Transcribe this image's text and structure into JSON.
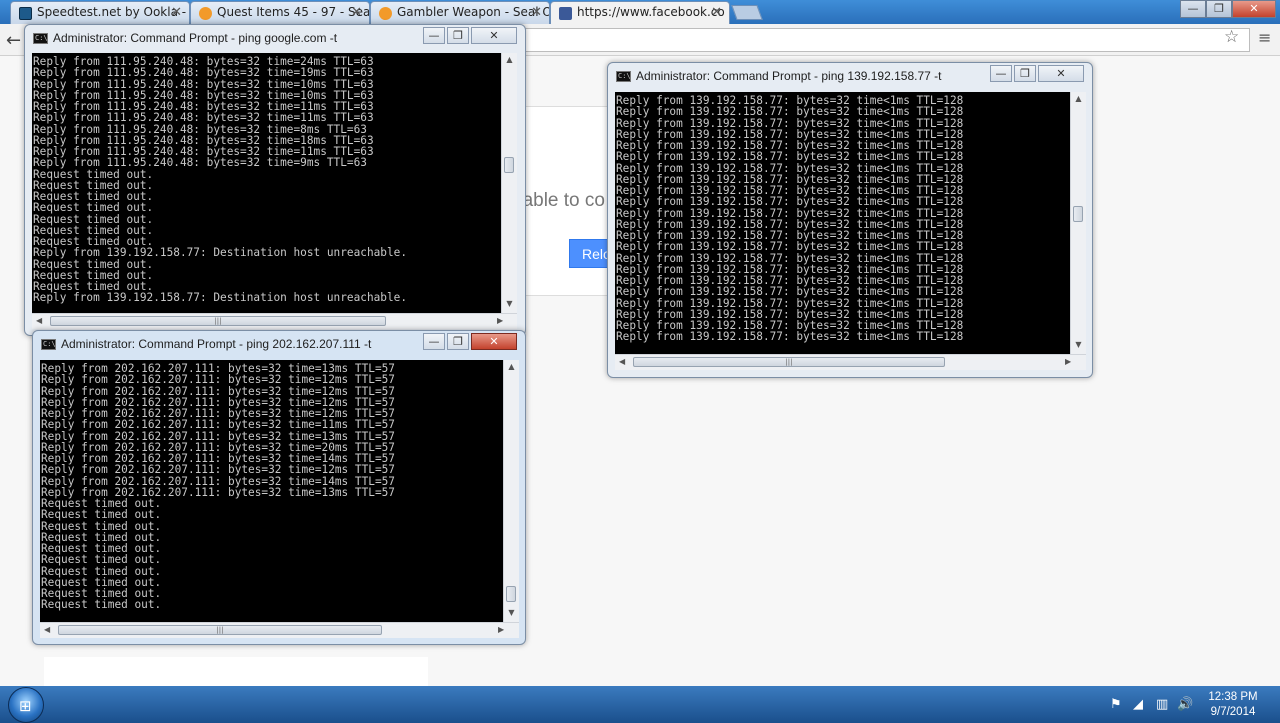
{
  "browser": {
    "tabs": [
      {
        "title": "Speedtest.net by Ookla - T",
        "favicon_color": "#1d5a8a",
        "favicon": "ookla-icon"
      },
      {
        "title": "Quest Items 45 - 97 - Seal",
        "favicon_color": "#f29a2a",
        "favicon": "seal-online-icon"
      },
      {
        "title": "Gambler Weapon - Seal O",
        "favicon_color": "#f29a2a",
        "favicon": "seal-online-icon"
      },
      {
        "title": "https://www.facebook.co",
        "favicon_color": "#3b5998",
        "favicon": "facebook-icon"
      }
    ],
    "window_controls": {
      "minimize": "—",
      "maximize": "❐",
      "close": "✕"
    },
    "back": "←",
    "star": "☆",
    "menu": "≡"
  },
  "page": {
    "error_text": "nable to co",
    "reload_label": "Relo"
  },
  "windows": [
    {
      "title": "Administrator: Command Prompt - ping  google.com -t",
      "lines": [
        "Reply from 111.95.240.48: bytes=32 time=24ms TTL=63",
        "Reply from 111.95.240.48: bytes=32 time=19ms TTL=63",
        "Reply from 111.95.240.48: bytes=32 time=10ms TTL=63",
        "Reply from 111.95.240.48: bytes=32 time=10ms TTL=63",
        "Reply from 111.95.240.48: bytes=32 time=11ms TTL=63",
        "Reply from 111.95.240.48: bytes=32 time=11ms TTL=63",
        "Reply from 111.95.240.48: bytes=32 time=8ms TTL=63",
        "Reply from 111.95.240.48: bytes=32 time=18ms TTL=63",
        "Reply from 111.95.240.48: bytes=32 time=11ms TTL=63",
        "Reply from 111.95.240.48: bytes=32 time=9ms TTL=63",
        "Request timed out.",
        "Request timed out.",
        "Request timed out.",
        "Request timed out.",
        "Request timed out.",
        "Request timed out.",
        "Request timed out.",
        "Reply from 139.192.158.77: Destination host unreachable.",
        "Request timed out.",
        "Request timed out.",
        "Request timed out.",
        "Reply from 139.192.158.77: Destination host unreachable."
      ]
    },
    {
      "title": "Administrator: Command Prompt - ping  139.192.158.77 -t",
      "lines": [
        "Reply from 139.192.158.77: bytes=32 time<1ms TTL=128",
        "Reply from 139.192.158.77: bytes=32 time<1ms TTL=128",
        "Reply from 139.192.158.77: bytes=32 time<1ms TTL=128",
        "Reply from 139.192.158.77: bytes=32 time<1ms TTL=128",
        "Reply from 139.192.158.77: bytes=32 time<1ms TTL=128",
        "Reply from 139.192.158.77: bytes=32 time<1ms TTL=128",
        "Reply from 139.192.158.77: bytes=32 time<1ms TTL=128",
        "Reply from 139.192.158.77: bytes=32 time<1ms TTL=128",
        "Reply from 139.192.158.77: bytes=32 time<1ms TTL=128",
        "Reply from 139.192.158.77: bytes=32 time<1ms TTL=128",
        "Reply from 139.192.158.77: bytes=32 time<1ms TTL=128",
        "Reply from 139.192.158.77: bytes=32 time<1ms TTL=128",
        "Reply from 139.192.158.77: bytes=32 time<1ms TTL=128",
        "Reply from 139.192.158.77: bytes=32 time<1ms TTL=128",
        "Reply from 139.192.158.77: bytes=32 time<1ms TTL=128",
        "Reply from 139.192.158.77: bytes=32 time<1ms TTL=128",
        "Reply from 139.192.158.77: bytes=32 time<1ms TTL=128",
        "Reply from 139.192.158.77: bytes=32 time<1ms TTL=128",
        "Reply from 139.192.158.77: bytes=32 time<1ms TTL=128",
        "Reply from 139.192.158.77: bytes=32 time<1ms TTL=128",
        "Reply from 139.192.158.77: bytes=32 time<1ms TTL=128",
        "Reply from 139.192.158.77: bytes=32 time<1ms TTL=128"
      ]
    },
    {
      "title": "Administrator: Command Prompt - ping  202.162.207.111 -t",
      "lines": [
        "Reply from 202.162.207.111: bytes=32 time=13ms TTL=57",
        "Reply from 202.162.207.111: bytes=32 time=12ms TTL=57",
        "Reply from 202.162.207.111: bytes=32 time=12ms TTL=57",
        "Reply from 202.162.207.111: bytes=32 time=12ms TTL=57",
        "Reply from 202.162.207.111: bytes=32 time=12ms TTL=57",
        "Reply from 202.162.207.111: bytes=32 time=11ms TTL=57",
        "Reply from 202.162.207.111: bytes=32 time=13ms TTL=57",
        "Reply from 202.162.207.111: bytes=32 time=20ms TTL=57",
        "Reply from 202.162.207.111: bytes=32 time=14ms TTL=57",
        "Reply from 202.162.207.111: bytes=32 time=12ms TTL=57",
        "Reply from 202.162.207.111: bytes=32 time=14ms TTL=57",
        "Reply from 202.162.207.111: bytes=32 time=13ms TTL=57",
        "Request timed out.",
        "Request timed out.",
        "Request timed out.",
        "Request timed out.",
        "Request timed out.",
        "Request timed out.",
        "Request timed out.",
        "Request timed out.",
        "Request timed out.",
        "Request timed out."
      ]
    }
  ],
  "console_icon_text": "C:\\",
  "scrollbar": {
    "grip": "|||",
    "up": "▲",
    "down": "▼",
    "left": "◀",
    "right": "▶"
  },
  "taskbar": {
    "start_glyph": "⊞",
    "tray_icons": [
      "action-center-icon",
      "network-icon",
      "signal-icon",
      "volume-icon"
    ],
    "tray_glyphs": [
      "⚑",
      "◢",
      "▥",
      "🔊"
    ],
    "time": "12:38 PM",
    "date": "9/7/2014"
  }
}
